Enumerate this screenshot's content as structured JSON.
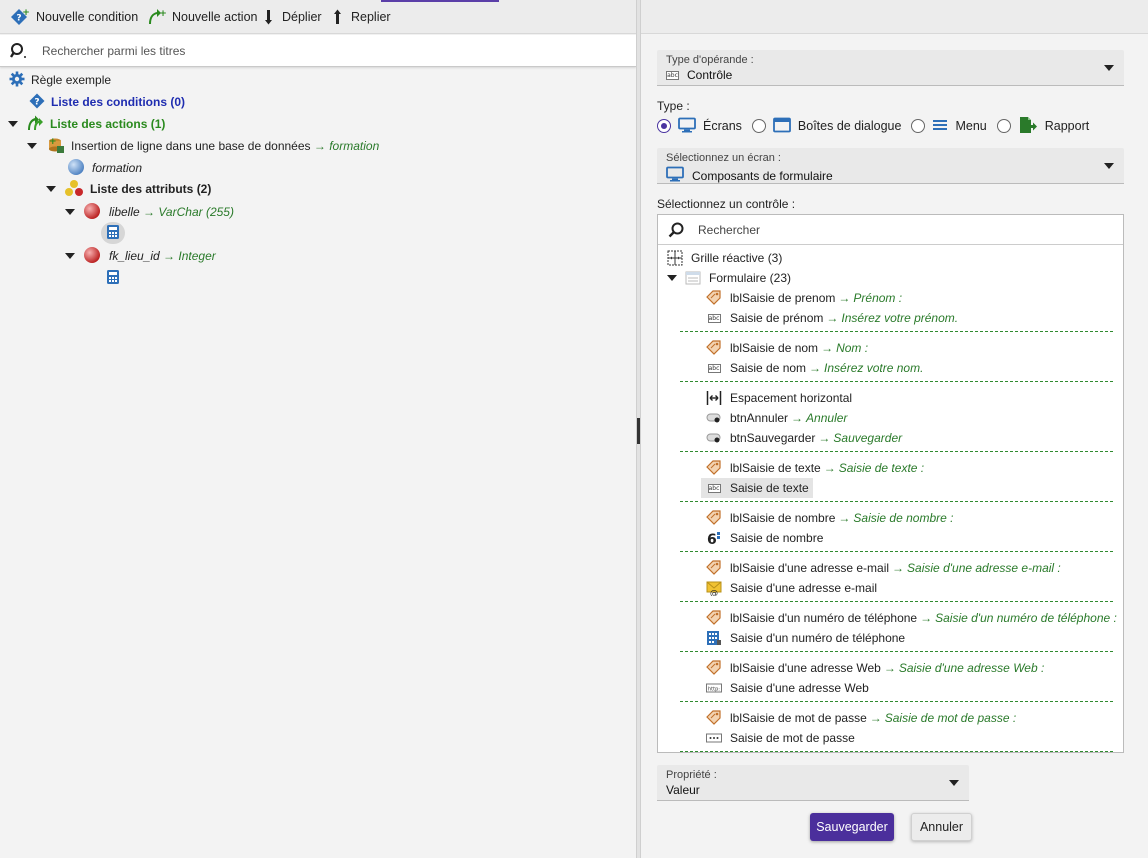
{
  "toolbar": {
    "new_condition": "Nouvelle condition",
    "new_action": "Nouvelle action",
    "expand": "Déplier",
    "collapse": "Replier"
  },
  "left_search": {
    "placeholder": "Rechercher parmi les titres"
  },
  "tree": {
    "root": "Règle exemple",
    "conditions": "Liste des conditions (0)",
    "actions": "Liste des actions (1)",
    "insert_prefix": "Insertion de ligne dans une base de données",
    "insert_target": "formation",
    "table_name": "formation",
    "attributes": "Liste des attributs (2)",
    "attr1_name": "libelle",
    "attr1_type": "VarChar (255)",
    "attr2_name": "fk_lieu_id",
    "attr2_type": "Integer",
    "arrow": "→"
  },
  "right": {
    "operand_label": "Type d'opérande :",
    "operand_value": "Contrôle",
    "type_label": "Type :",
    "type_options": [
      "Écrans",
      "Boîtes de dialogue",
      "Menu",
      "Rapport"
    ],
    "type_selected": "Écrans",
    "screen_label": "Sélectionnez un écran :",
    "screen_value": "Composants de formulaire",
    "control_label": "Sélectionnez un contrôle :",
    "control_search_placeholder": "Rechercher",
    "controls": {
      "grid": "Grille réactive (3)",
      "form": "Formulaire (23)",
      "items": [
        {
          "name": "lblSaisie de prenom",
          "value": "Prénom :",
          "icon": "label-tag-icon"
        },
        {
          "name": "Saisie de prénom",
          "value": "Insérez votre prénom.",
          "icon": "text-input-icon"
        },
        {
          "name": "lblSaisie de nom",
          "value": "Nom :",
          "icon": "label-tag-icon"
        },
        {
          "name": "Saisie de nom",
          "value": "Insérez votre nom.",
          "icon": "text-input-icon"
        },
        {
          "name": "Espacement horizontal",
          "value": "",
          "icon": "horizontal-spacing-icon"
        },
        {
          "name": "btnAnnuler",
          "value": "Annuler",
          "icon": "button-toggle-icon"
        },
        {
          "name": "btnSauvegarder",
          "value": "Sauvegarder",
          "icon": "button-toggle-icon"
        },
        {
          "name": "lblSaisie de texte",
          "value": "Saisie de texte :",
          "icon": "label-tag-icon"
        },
        {
          "name": "Saisie de texte",
          "value": "",
          "icon": "text-input-icon"
        },
        {
          "name": "lblSaisie de nombre",
          "value": "Saisie de nombre :",
          "icon": "label-tag-icon"
        },
        {
          "name": "Saisie de nombre",
          "value": "",
          "icon": "number-input-icon"
        },
        {
          "name": "lblSaisie d'une adresse e-mail",
          "value": "Saisie d'une adresse e-mail :",
          "icon": "label-tag-icon"
        },
        {
          "name": "Saisie d'une adresse e-mail",
          "value": "",
          "icon": "email-input-icon"
        },
        {
          "name": "lblSaisie d'un numéro de téléphone",
          "value": "Saisie d'un numéro de téléphone :",
          "icon": "label-tag-icon"
        },
        {
          "name": "Saisie d'un numéro de téléphone",
          "value": "",
          "icon": "phone-input-icon"
        },
        {
          "name": "lblSaisie d'une adresse Web",
          "value": "Saisie d'une adresse Web :",
          "icon": "label-tag-icon"
        },
        {
          "name": "Saisie d'une adresse Web",
          "value": "",
          "icon": "url-input-icon"
        },
        {
          "name": "lblSaisie de mot de passe",
          "value": "Saisie de mot de passe :",
          "icon": "label-tag-icon"
        },
        {
          "name": "Saisie de mot de passe",
          "value": "",
          "icon": "password-input-icon"
        }
      ]
    },
    "property_label": "Propriété :",
    "property_value": "Valeur",
    "save_label": "Sauvegarder",
    "cancel_label": "Annuler"
  },
  "colors": {
    "accent": "#4b2f9c",
    "green": "#2a7a2a",
    "blue": "#1f2db0"
  }
}
